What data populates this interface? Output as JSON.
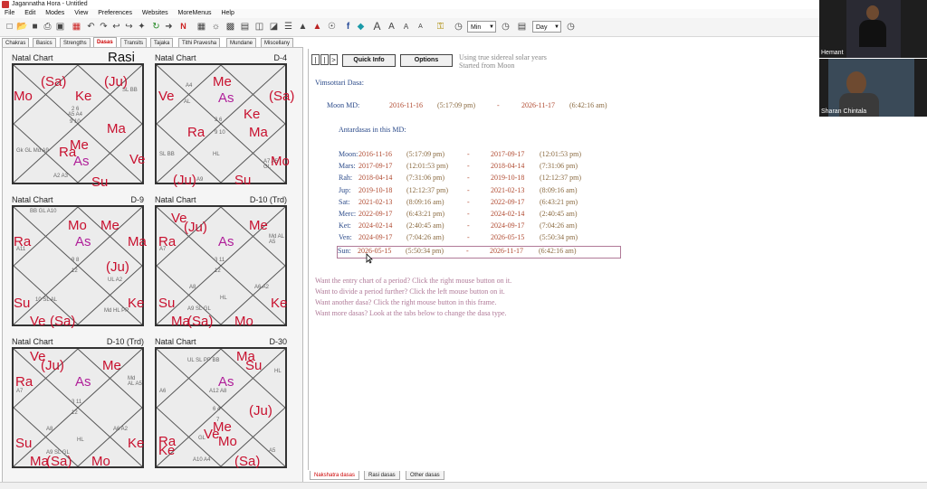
{
  "title": "Jagannatha Hora - Untitled",
  "menu": [
    "File",
    "Edit",
    "Modes",
    "View",
    "Preferences",
    "Websites",
    "MoreMenus",
    "Help"
  ],
  "toolbar": {
    "min_value": "Min",
    "day_value": "Day"
  },
  "left_tabs": [
    "Chakras",
    "Basics",
    "Strengths",
    "Dasas",
    "Transits",
    "Tajaka",
    "Tithi Pravesha",
    "Mundane",
    "Miscellany"
  ],
  "charts": [
    {
      "name": "Natal Chart",
      "division": "",
      "overlay": "Rasi",
      "planets": [
        [
          "Mo",
          "red"
        ],
        [
          "(Sa)",
          "red"
        ],
        [
          "Ke",
          "red"
        ],
        [
          "(Ju)",
          "red"
        ],
        [
          "Ma",
          "red"
        ],
        [
          "Me",
          "red"
        ],
        [
          "Ra",
          "red"
        ],
        [
          "As",
          "mag"
        ],
        [
          "Ve",
          "red"
        ],
        [
          "Su",
          "red"
        ]
      ]
    },
    {
      "name": "Natal Chart",
      "division": "D-4",
      "overlay": "",
      "planets": [
        [
          "Ve",
          "red"
        ],
        [
          "Me",
          "red"
        ],
        [
          "As",
          "mag"
        ],
        [
          "(Sa)",
          "red"
        ],
        [
          "Ke",
          "red"
        ],
        [
          "Ra",
          "red"
        ],
        [
          "Ma",
          "red"
        ],
        [
          "Mo",
          "red"
        ],
        [
          "(Ju)",
          "red"
        ],
        [
          "Su",
          "red"
        ]
      ]
    },
    {
      "name": "Natal Chart",
      "division": "D-9",
      "overlay": "",
      "planets": [
        [
          "Ra",
          "red"
        ],
        [
          "Mo",
          "red"
        ],
        [
          "Me",
          "red"
        ],
        [
          "As",
          "mag"
        ],
        [
          "Ma",
          "red"
        ],
        [
          "(Ju)",
          "red"
        ],
        [
          "Su",
          "red"
        ],
        [
          "Ke",
          "red"
        ],
        [
          "Ve",
          "red"
        ],
        [
          "(Sa)",
          "red"
        ]
      ]
    },
    {
      "name": "Natal Chart",
      "division": "D-10 (Trd)",
      "overlay": "",
      "planets": [
        [
          "Ve",
          "red"
        ],
        [
          "(Ju)",
          "red"
        ],
        [
          "Ra",
          "red"
        ],
        [
          "As",
          "mag"
        ],
        [
          "Me",
          "red"
        ],
        [
          "Su",
          "red"
        ],
        [
          "Ke",
          "red"
        ],
        [
          "Ma",
          "red"
        ],
        [
          "(Sa)",
          "red"
        ],
        [
          "Mo",
          "red"
        ]
      ]
    },
    {
      "name": "Natal Chart",
      "division": "D-10 (Trd)",
      "overlay": "",
      "planets": [
        [
          "Ve",
          "red"
        ],
        [
          "(Ju)",
          "red"
        ],
        [
          "Ra",
          "red"
        ],
        [
          "As",
          "mag"
        ],
        [
          "Me",
          "red"
        ],
        [
          "Su",
          "red"
        ],
        [
          "Ke",
          "red"
        ],
        [
          "Ma",
          "red"
        ],
        [
          "(Sa)",
          "red"
        ],
        [
          "Mo",
          "red"
        ]
      ]
    },
    {
      "name": "Natal Chart",
      "division": "D-30",
      "overlay": "",
      "planets": [
        [
          "Ma",
          "red"
        ],
        [
          "Su",
          "red"
        ],
        [
          "As",
          "mag"
        ],
        [
          "(Ju)",
          "red"
        ],
        [
          "Me",
          "red"
        ],
        [
          "Ve",
          "red"
        ],
        [
          "Mo",
          "red"
        ],
        [
          "Ra",
          "red"
        ],
        [
          "Ke",
          "red"
        ],
        [
          "(Sa)",
          "red"
        ]
      ]
    }
  ],
  "dasa": {
    "nav": [
      "|",
      "|",
      ">"
    ],
    "quick_info": "Quick Info",
    "options": "Options",
    "note_line1": "Using true sidereal solar years",
    "note_line2": "Started from Moon",
    "system": "Vimsottari Dasa:",
    "md": {
      "label": "Moon MD:",
      "start_date": "2016-11-16",
      "start_time": "(5:17:09 pm)",
      "dash": "-",
      "end_date": "2026-11-17",
      "end_time": "(6:42:16 am)"
    },
    "antar_header": "Antardasas in this MD:",
    "antardasas": [
      {
        "name": "Moon:",
        "start_date": "2016-11-16",
        "start_time": "(5:17:09 pm)",
        "dash": "-",
        "end_date": "2017-09-17",
        "end_time": "(12:01:53 pm)"
      },
      {
        "name": "Mars:",
        "start_date": "2017-09-17",
        "start_time": "(12:01:53 pm)",
        "dash": "-",
        "end_date": "2018-04-14",
        "end_time": "(7:31:06 pm)"
      },
      {
        "name": "Rah:",
        "start_date": "2018-04-14",
        "start_time": "(7:31:06 pm)",
        "dash": "-",
        "end_date": "2019-10-18",
        "end_time": "(12:12:37 pm)"
      },
      {
        "name": "Jup:",
        "start_date": "2019-10-18",
        "start_time": "(12:12:37 pm)",
        "dash": "-",
        "end_date": "2021-02-13",
        "end_time": "(8:09:16 am)"
      },
      {
        "name": "Sat:",
        "start_date": "2021-02-13",
        "start_time": "(8:09:16 am)",
        "dash": "-",
        "end_date": "2022-09-17",
        "end_time": "(6:43:21 pm)"
      },
      {
        "name": "Merc:",
        "start_date": "2022-09-17",
        "start_time": "(6:43:21 pm)",
        "dash": "-",
        "end_date": "2024-02-14",
        "end_time": "(2:40:45 am)"
      },
      {
        "name": "Ket:",
        "start_date": "2024-02-14",
        "start_time": "(2:40:45 am)",
        "dash": "-",
        "end_date": "2024-09-17",
        "end_time": "(7:04:26 am)"
      },
      {
        "name": "Ven:",
        "start_date": "2024-09-17",
        "start_time": "(7:04:26 am)",
        "dash": "-",
        "end_date": "2026-05-15",
        "end_time": "(5:50:34 pm)"
      },
      {
        "name": "Sun:",
        "start_date": "2026-05-15",
        "start_time": "(5:50:34 pm)",
        "dash": "-",
        "end_date": "2026-11-17",
        "end_time": "(6:42:16 am)"
      }
    ],
    "hints": [
      "Want the entry chart of a period? Click the right mouse button on it.",
      "Want to divide a period further? Click the left mouse button on it.",
      "Want another dasa? Click the right mouse button in this frame.",
      "Want more dasas? Look at the tabs below to change the dasa type."
    ]
  },
  "bottom_tabs": [
    "Nakshatra dasas",
    "Rasi dasas",
    "Other dasas"
  ],
  "participants": [
    "Hemant",
    "Sharan Chintala"
  ],
  "colors": {
    "red": "#c8102e",
    "magenta": "#b0209a",
    "blue": "#2c4b8a",
    "date": "#b04a30",
    "hint": "#b07a98"
  }
}
